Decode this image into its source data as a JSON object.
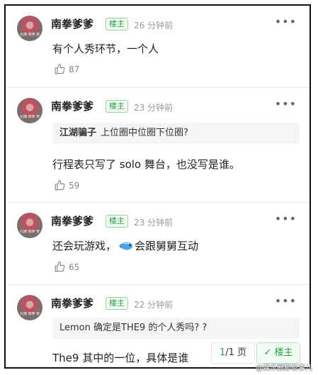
{
  "comments": [
    {
      "username": "南拳爹爹",
      "badge": "楼主",
      "time": "26 分钟前",
      "more": "•••",
      "text": "有个人秀环节，一个人",
      "likes": "87"
    },
    {
      "username": "南拳爹爹",
      "badge": "楼主",
      "time": "23 分钟前",
      "more": "•••",
      "quote_name": "江湖骗子",
      "quote_text": "上位圈中位圈下位圈?",
      "text": "行程表只写了 solo 舞台，也没写是谁。",
      "likes": "59"
    },
    {
      "username": "南拳爹爹",
      "badge": "楼主",
      "time": "23 分钟前",
      "more": "•••",
      "text_before": "还会玩游戏，",
      "text_after": "会跟舅舅互动",
      "likes": "65"
    },
    {
      "username": "南拳爹爹",
      "badge": "楼主",
      "time": "22 分钟前",
      "more": "•••",
      "quote_text": "Lemon 确定是THE9 的个人秀吗? ?",
      "text": "The9 其中的一位，具体是谁"
    }
  ],
  "pagination": {
    "current": "1",
    "total": "/1 页"
  },
  "owner_button": {
    "check": "✓",
    "label": "楼主"
  },
  "avatar_text": "北魏 南拳 爹",
  "watermark": "@娱乐圈那些事儿",
  "colors": {
    "accent": "#2ba245",
    "badge_bg": "#f2fbf4",
    "quote_bg": "#f5f5f5"
  }
}
